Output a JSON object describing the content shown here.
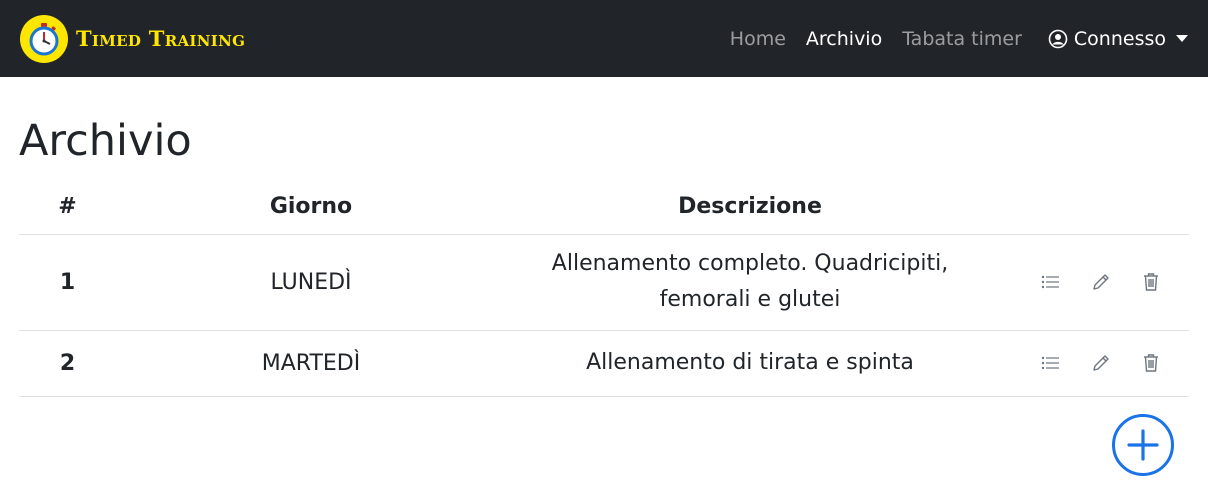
{
  "brand": {
    "name": "Timed Training"
  },
  "nav": {
    "links": [
      "Home",
      "Archivio",
      "Tabata timer"
    ],
    "user_label": "Connesso"
  },
  "page": {
    "title": "Archivio"
  },
  "table": {
    "columns": [
      "#",
      "Giorno",
      "Descrizione"
    ],
    "rows": [
      {
        "num": "1",
        "day": "LUNEDÌ",
        "desc_line1": "Allenamento completo. Quadricipiti,",
        "desc_line2": "femorali e glutei"
      },
      {
        "num": "2",
        "day": "MARTEDÌ",
        "desc_line1": "Allenamento di tirata e spinta",
        "desc_line2": ""
      }
    ]
  },
  "colors": {
    "navbar": "#212529",
    "brand": "#ffe600",
    "accent": "#1a73e8",
    "icon": "#6c757d"
  },
  "icons": [
    "stopwatch-icon",
    "user-circle-icon",
    "list-icon",
    "pencil-icon",
    "trash-icon",
    "plus-circle-icon"
  ]
}
